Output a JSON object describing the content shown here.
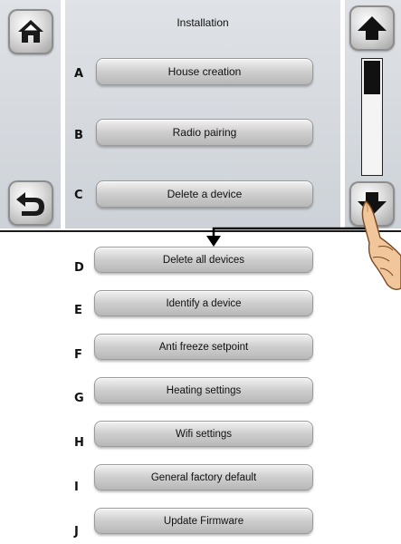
{
  "screen": {
    "title": "Installation",
    "visible_items": [
      {
        "letter": "A",
        "label": "House creation"
      },
      {
        "letter": "B",
        "label": "Radio pairing"
      },
      {
        "letter": "C",
        "label": "Delete a device"
      }
    ],
    "icons": {
      "home": "home-icon",
      "back": "back-arrow-icon",
      "scroll_up": "arrow-up-icon",
      "scroll_down": "arrow-down-icon"
    },
    "scrollbar": {
      "position": 0.0,
      "visible_fraction": 0.3
    }
  },
  "extended_list": [
    {
      "letter": "D",
      "label": "Delete all devices"
    },
    {
      "letter": "E",
      "label": "Identify a device"
    },
    {
      "letter": "F",
      "label": "Anti freeze setpoint"
    },
    {
      "letter": "G",
      "label": "Heating settings"
    },
    {
      "letter": "H",
      "label": "Wifi settings"
    },
    {
      "letter": "I",
      "label": "General factory default"
    },
    {
      "letter": "J",
      "label": "Update Firmware"
    }
  ],
  "colors": {
    "panel": "#d6dadf",
    "button_face": "#d2d2d2",
    "text": "#111111",
    "callout_line": "#000000",
    "hand_skin": "#f0c69a"
  }
}
